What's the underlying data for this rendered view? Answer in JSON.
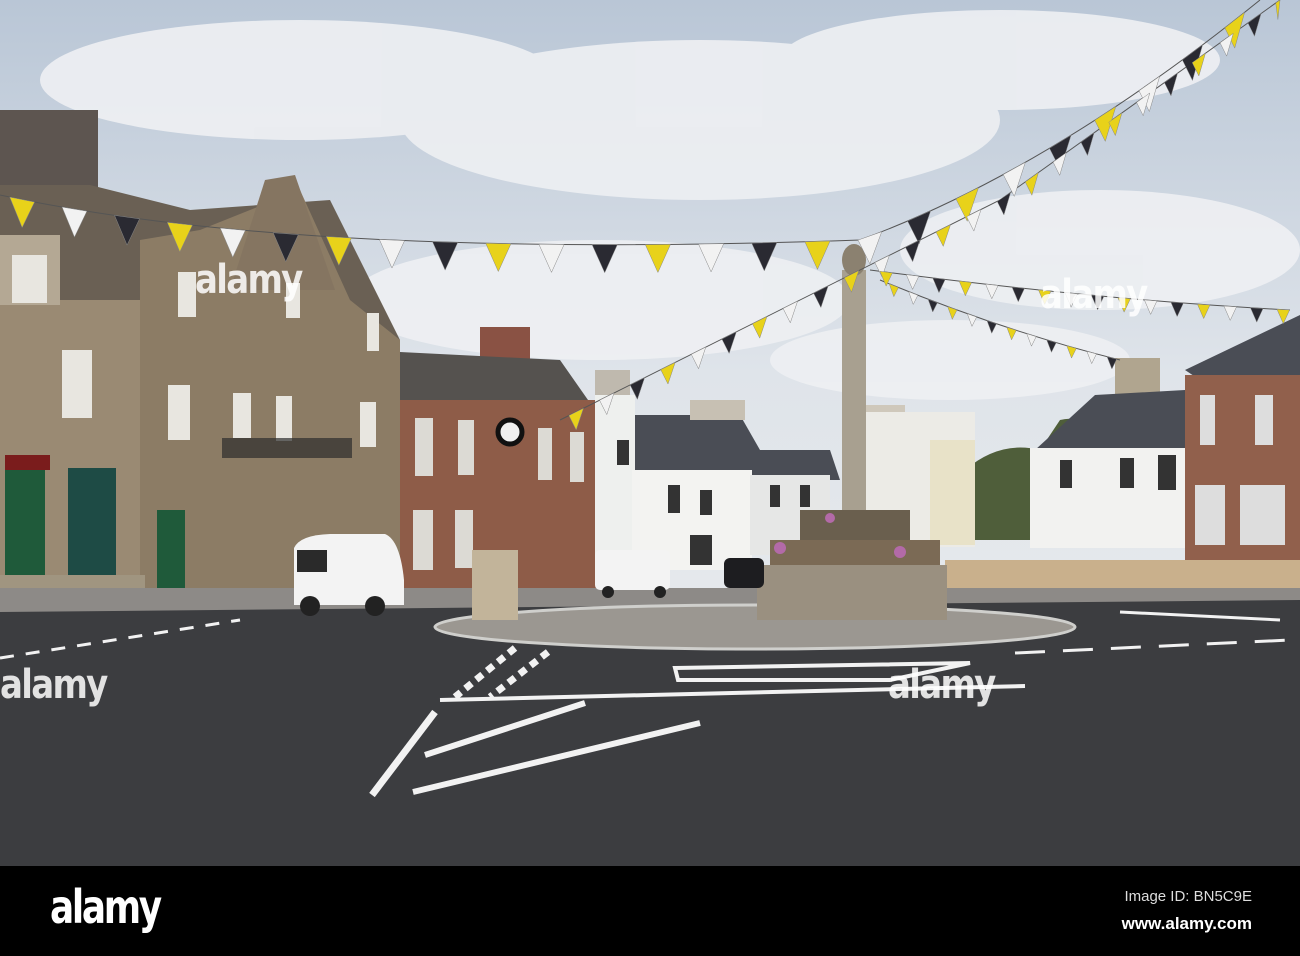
{
  "photo": {
    "subject": "Town square roundabout with mercat cross and bunting",
    "colors": {
      "sky": "#c9d4e0",
      "road": "#3c3d40",
      "stone": "#8a7a64",
      "sandstone": "#8e5c48",
      "white_building": "#eef0ee",
      "flag_yellow": "#e8d21a",
      "flag_black": "#2a2a32",
      "flag_white": "#f2f2f2"
    }
  },
  "watermark": {
    "text": "alamy"
  },
  "footer": {
    "logo": "alamy",
    "image_id": "Image ID: BN5C9E",
    "website": "www.alamy.com"
  }
}
